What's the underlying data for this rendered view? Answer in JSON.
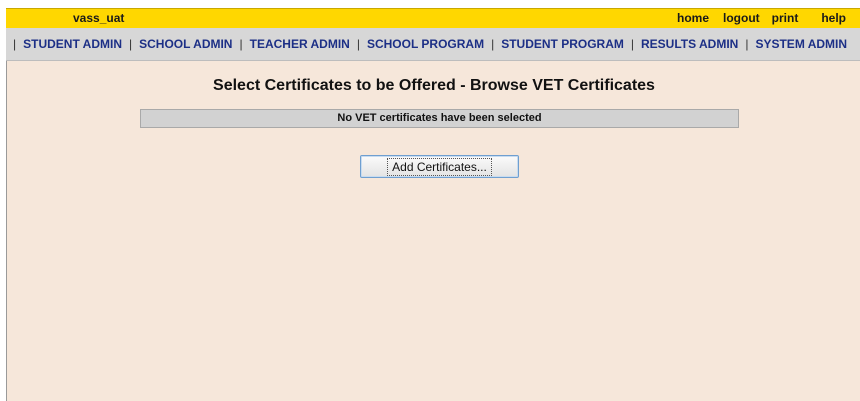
{
  "header": {
    "env_label": "vass_uat",
    "links": {
      "home": "home",
      "logout": "logout",
      "print": "print",
      "help": "help"
    }
  },
  "nav": {
    "items": [
      {
        "label": "STUDENT ADMIN"
      },
      {
        "label": "SCHOOL ADMIN"
      },
      {
        "label": "TEACHER ADMIN"
      },
      {
        "label": "SCHOOL PROGRAM"
      },
      {
        "label": "STUDENT PROGRAM"
      },
      {
        "label": "RESULTS ADMIN"
      },
      {
        "label": "SYSTEM ADMIN"
      }
    ],
    "separator": "|"
  },
  "main": {
    "title": "Select Certificates to be Offered - Browse VET Certificates",
    "empty_message": "No VET certificates have been selected",
    "add_button_label": "Add Certificates..."
  },
  "colors": {
    "header_bg": "#ffd700",
    "nav_bg": "#d7d7d7",
    "nav_link": "#1c2f86",
    "content_bg": "#f6e7da"
  }
}
